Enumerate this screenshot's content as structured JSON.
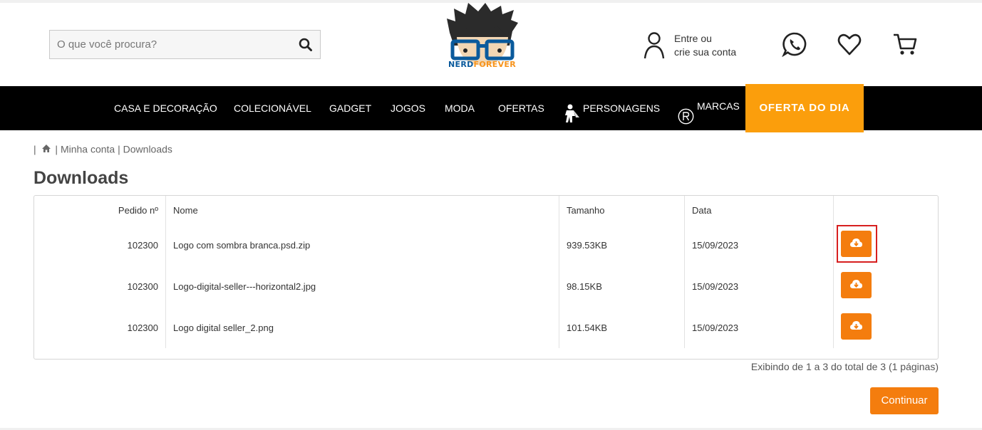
{
  "header": {
    "search": {
      "placeholder": "O que você procura?",
      "icon": "search-icon"
    },
    "logo": {
      "text_part1": "NERD",
      "text_part2": "FOREVER"
    },
    "account": {
      "line1": "Entre ou",
      "line2": "crie sua conta",
      "icon": "user-icon"
    },
    "icons": [
      "whatsapp-icon",
      "heart-icon",
      "cart-icon"
    ]
  },
  "nav": {
    "items": [
      {
        "label": "CASA E DECORAÇÃO"
      },
      {
        "label": "COLECIONÁVEL"
      },
      {
        "label": "GADGET"
      },
      {
        "label": "JOGOS"
      },
      {
        "label": "MODA"
      },
      {
        "label": "OFERTAS"
      },
      {
        "label": "PERSONAGENS",
        "icon": "character-icon"
      },
      {
        "label": "MARCAS",
        "icon": "registered-icon"
      }
    ],
    "highlight": "OFERTA DO DIA"
  },
  "breadcrumb": {
    "sep": "|",
    "home_icon": "home-icon",
    "account": "Minha conta",
    "current": "Downloads"
  },
  "page": {
    "title": "Downloads"
  },
  "table": {
    "headers": {
      "order": "Pedido nº",
      "name": "Nome",
      "size": "Tamanho",
      "date": "Data"
    },
    "rows": [
      {
        "order": "102300",
        "name": "Logo com sombra branca.psd.zip",
        "size": "939.53KB",
        "date": "15/09/2023"
      },
      {
        "order": "102300",
        "name": "Logo-digital-seller---horizontal2.jpg",
        "size": "98.15KB",
        "date": "15/09/2023"
      },
      {
        "order": "102300",
        "name": "Logo digital seller_2.png",
        "size": "101.54KB",
        "date": "15/09/2023"
      }
    ],
    "download_icon": "cloud-download-icon"
  },
  "summary": "Exibindo de 1 a 3 do total de 3 (1 páginas)",
  "continue_label": "Continuar",
  "colors": {
    "accent": "#f47d0e",
    "oferta": "#fb9e0c",
    "nav_bg": "#000000",
    "highlight_border": "#d71f1f"
  }
}
